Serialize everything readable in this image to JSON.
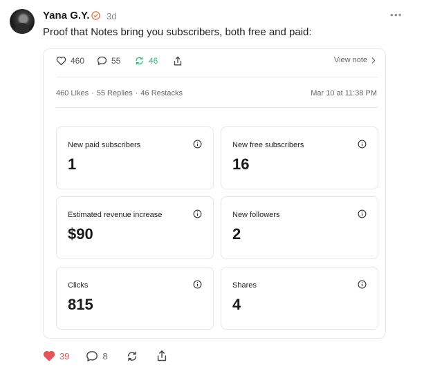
{
  "author": {
    "name": "Yana G.Y.",
    "time": "3d"
  },
  "post": {
    "text": "Proof that Notes bring you subscribers, both free and paid:"
  },
  "note": {
    "stats": {
      "likes": "460",
      "replies": "55",
      "restacks": "46"
    },
    "view_note_label": "View note",
    "summary": {
      "likes": "460 Likes",
      "replies": "55 Replies",
      "restacks": "46 Restacks",
      "dot": "·"
    },
    "timestamp": "Mar 10 at 11:38 PM",
    "metrics": [
      {
        "label": "New paid subscribers",
        "value": "1"
      },
      {
        "label": "New free subscribers",
        "value": "16"
      },
      {
        "label": "Estimated revenue increase",
        "value": "$90"
      },
      {
        "label": "New followers",
        "value": "2"
      },
      {
        "label": "Clicks",
        "value": "815"
      },
      {
        "label": "Shares",
        "value": "4"
      }
    ]
  },
  "footer": {
    "likes": "39",
    "replies": "8"
  },
  "colors": {
    "restack": "#2bbf7b",
    "like": "#e0565b",
    "verified": "#e8733a"
  }
}
